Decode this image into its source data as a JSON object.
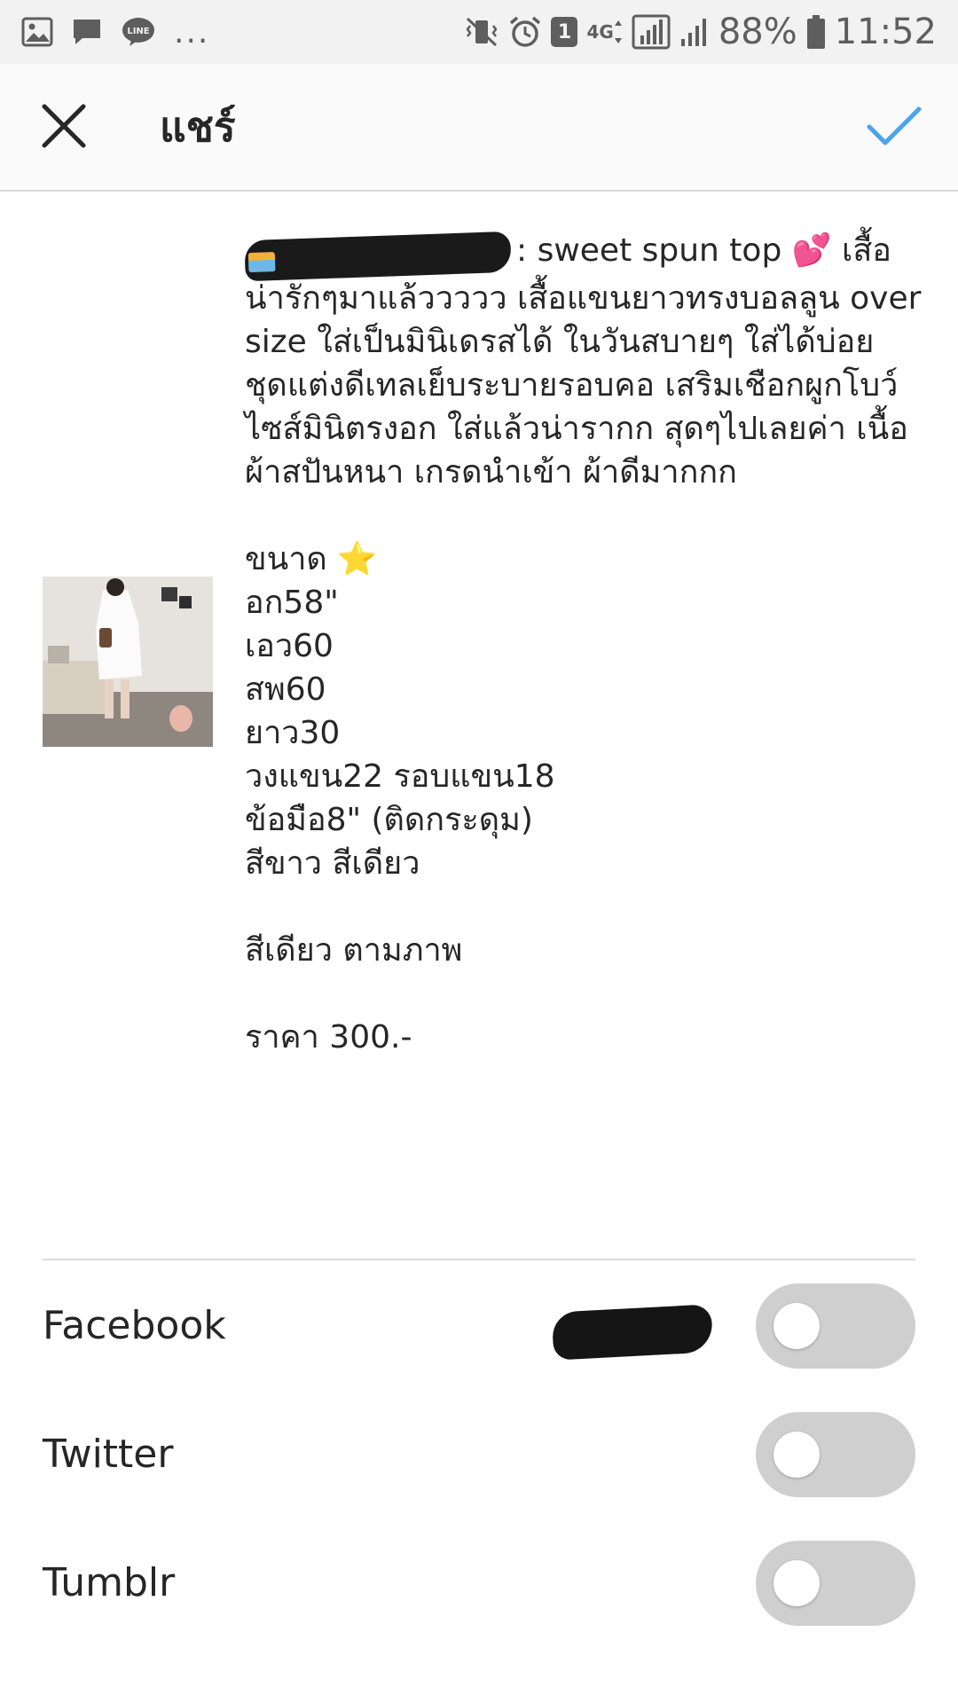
{
  "status_bar": {
    "icons_left": [
      "gallery-icon",
      "message-icon",
      "line-icon"
    ],
    "overflow": "...",
    "network": "4G",
    "sim": "1",
    "battery": "88%",
    "time": "11:52"
  },
  "header": {
    "title": "แชร์",
    "close_icon": "close-icon",
    "confirm_icon": "checkmark-icon",
    "confirm_color": "#4aa3ed"
  },
  "post": {
    "thumbnail_alt": "product photo",
    "caption_intro": ": sweet spun top 💕 เสื้อน่ารักๆมาแล้ววววว เสื้อแขนยาวทรงบอลลูน over size ใส่เป็นมินิเดรสได้ ในวันสบายๆ ใส่ได้บ่อย ชุดแต่งดีเทลเย็บระบายรอบคอ เสริมเชือกผูกโบว์ไซส์มินิตรงอก ใส่แล้วน่ารากก สุดๆไปเลยค่า เนื้อผ้าสปันหนา เกรดนำเข้า ผ้าดีมากกก",
    "caption_details": "\nขนาด ⭐\nอก58\"\nเอว60\nสพ60\nยาว30\nวงแขน22 รอบแขน18\nข้อมือ8\" (ติดกระดุม)\nสีขาว สีเดียว\n\nสีเดียว ตามภาพ\n\nราคา 300.-"
  },
  "share_targets": [
    {
      "label": "Facebook",
      "enabled": false
    },
    {
      "label": "Twitter",
      "enabled": false
    },
    {
      "label": "Tumblr",
      "enabled": false
    }
  ],
  "colors": {
    "toggle_off": "#cfcfcf",
    "header_bg": "#fafafa",
    "status_bar_bg": "#f2f2f2"
  }
}
